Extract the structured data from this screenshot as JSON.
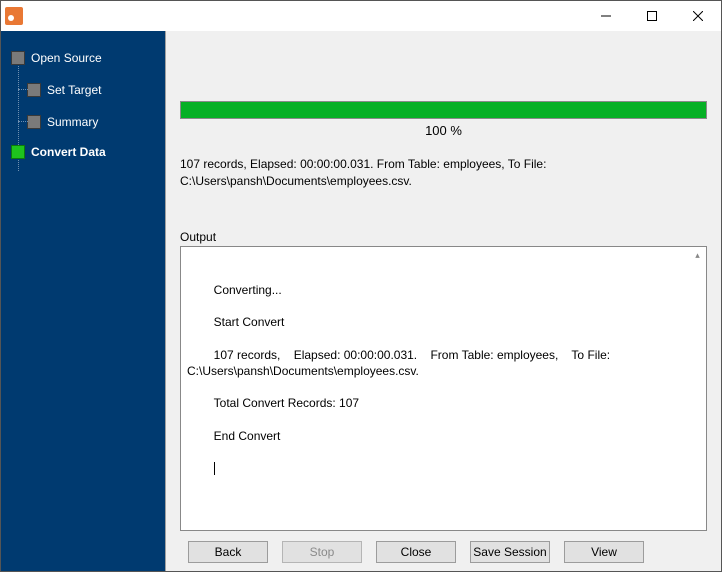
{
  "titlebar": {
    "title": ""
  },
  "sidebar": {
    "items": [
      {
        "label": "Open Source",
        "level": "parent",
        "active": false,
        "bold": false
      },
      {
        "label": "Set Target",
        "level": "child",
        "active": false,
        "bold": false
      },
      {
        "label": "Summary",
        "level": "child",
        "active": false,
        "bold": false
      },
      {
        "label": "Convert Data",
        "level": "parent",
        "active": true,
        "bold": true
      }
    ]
  },
  "progress": {
    "percent": 100,
    "percent_label": "100 %"
  },
  "status": {
    "line1": "107 records,    Elapsed: 00:00:00.031.    From Table: employees,    To File:",
    "line2": "C:\\Users\\pansh\\Documents\\employees.csv."
  },
  "output": {
    "label": "Output",
    "lines": [
      "Converting...",
      "Start Convert",
      "107 records,    Elapsed: 00:00:00.031.    From Table: employees,    To File: C:\\Users\\pansh\\Documents\\employees.csv.",
      "Total Convert Records: 107",
      "End Convert"
    ]
  },
  "buttons": {
    "back": "Back",
    "stop": "Stop",
    "close": "Close",
    "save_session": "Save Session",
    "view": "View"
  }
}
